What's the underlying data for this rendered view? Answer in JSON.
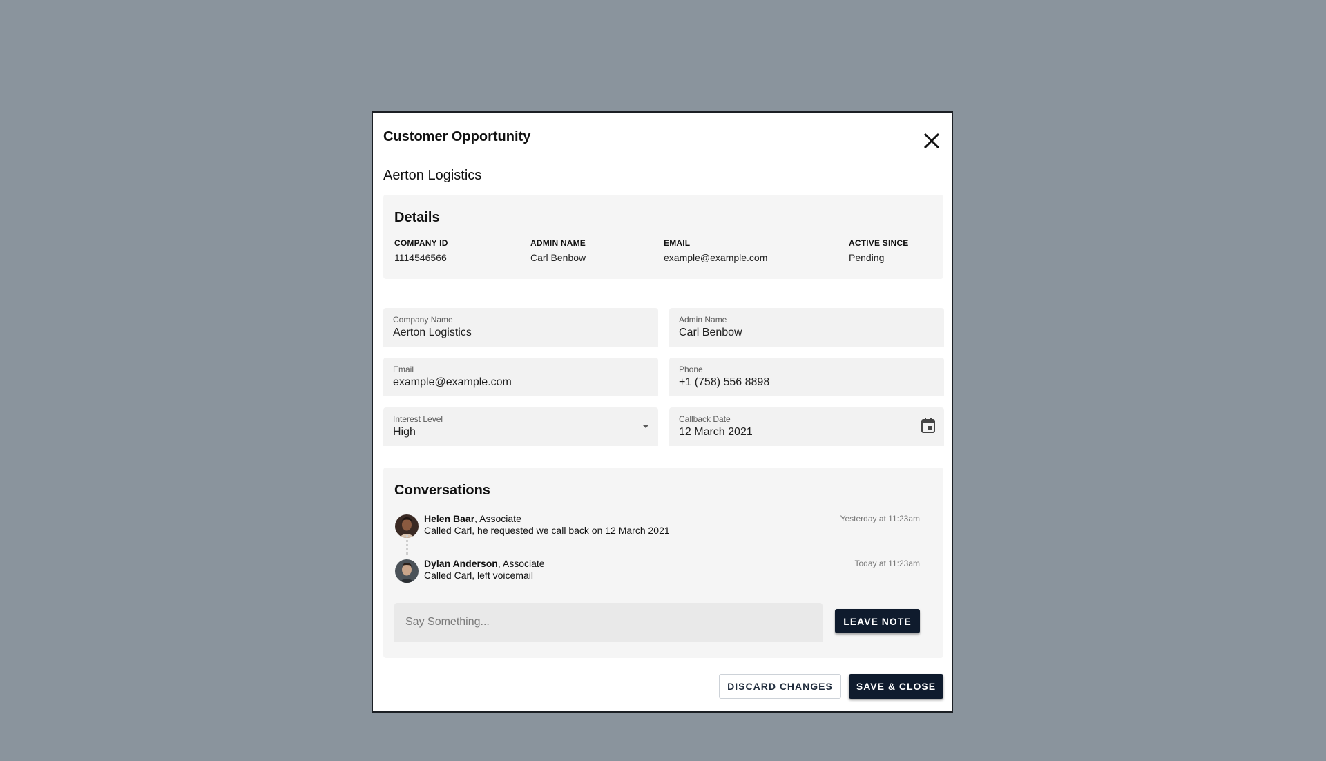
{
  "dialog": {
    "title": "Customer Opportunity",
    "company_heading": "Aerton Logistics"
  },
  "details": {
    "title": "Details",
    "items": [
      {
        "key": "COMPANY ID",
        "value": "1114546566"
      },
      {
        "key": "ADMIN NAME",
        "value": "Carl Benbow"
      },
      {
        "key": "EMAIL",
        "value": "example@example.com"
      },
      {
        "key": "ACTIVE SINCE",
        "value": "Pending"
      }
    ]
  },
  "form": {
    "company_name": {
      "label": "Company Name",
      "value": "Aerton Logistics"
    },
    "admin_name": {
      "label": "Admin Name",
      "value": "Carl Benbow"
    },
    "email": {
      "label": "Email",
      "value": "example@example.com"
    },
    "phone": {
      "label": "Phone",
      "value": "+1 (758) 556 8898"
    },
    "interest_level": {
      "label": "Interest Level",
      "value": "High",
      "icon": "dropdown-arrow-icon"
    },
    "callback_date": {
      "label": "Callback Date",
      "value": "12 March 2021",
      "icon": "calendar-icon"
    }
  },
  "conversations": {
    "title": "Conversations",
    "items": [
      {
        "name": "Helen Baar",
        "role": ", Associate",
        "message": "Called Carl, he requested we call back on 12 March 2021",
        "time": "Yesterday at 11:23am"
      },
      {
        "name": "Dylan Anderson",
        "role": ", Associate",
        "message": "Called Carl, left voicemail",
        "time": "Today at 11:23am"
      }
    ],
    "note_placeholder": "Say Something...",
    "leave_note_label": "LEAVE NOTE"
  },
  "footer": {
    "discard_label": "DISCARD CHANGES",
    "save_label": "SAVE & CLOSE"
  },
  "colors": {
    "backdrop": "#8a949d",
    "primary_button": "#0f1b2d",
    "panel": "#f5f5f5"
  }
}
